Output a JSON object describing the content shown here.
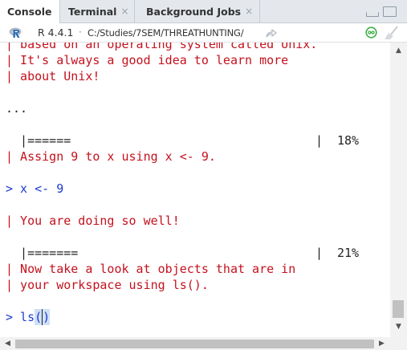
{
  "tabs": [
    {
      "label": "Console",
      "closable": false
    },
    {
      "label": "Terminal",
      "closable": true
    },
    {
      "label": "Background Jobs",
      "closable": true
    }
  ],
  "close_glyph": "×",
  "pathbar": {
    "r_version": "R 4.4.1",
    "separator": "·",
    "path": "C:/Studies/7SEM/THREATHUNTING/",
    "goto_icon": "share-arrow-icon"
  },
  "console_lines": [
    {
      "text": "| based on an operating system called Unix.",
      "kind": "msg"
    },
    {
      "text": "| It's always a good idea to learn more",
      "kind": "msg"
    },
    {
      "text": "| about Unix!",
      "kind": "msg"
    },
    {
      "text": "",
      "kind": "blank"
    },
    {
      "text": "...",
      "kind": "dark"
    },
    {
      "text": "",
      "kind": "blank"
    },
    {
      "text": "  |======",
      "kind": "dark",
      "pct": "18%",
      "bar_end": "|"
    },
    {
      "text": "| Assign 9 to x using x <- 9.",
      "kind": "msg"
    },
    {
      "text": "",
      "kind": "blank"
    },
    {
      "text": "> x <- 9",
      "kind": "prompt"
    },
    {
      "text": "",
      "kind": "blank"
    },
    {
      "text": "| You are doing so well!",
      "kind": "msg"
    },
    {
      "text": "",
      "kind": "blank"
    },
    {
      "text": "  |=======",
      "kind": "dark",
      "pct": "21%",
      "bar_end": "|"
    },
    {
      "text": "| Now take a look at objects that are in",
      "kind": "msg"
    },
    {
      "text": "| your workspace using ls().",
      "kind": "msg"
    },
    {
      "text": "",
      "kind": "blank"
    },
    {
      "text": "> ls()",
      "kind": "prompt-input"
    }
  ],
  "colors": {
    "message": "#c4121e",
    "prompt": "#1b3bd1",
    "output": "#222222",
    "tab_bar": "#e4e8ec"
  }
}
